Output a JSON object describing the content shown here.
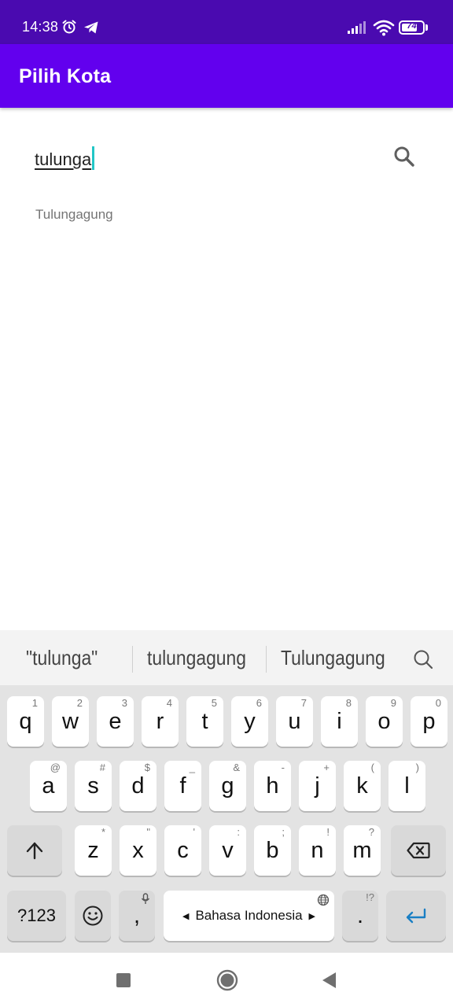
{
  "status_bar": {
    "time": "14:38",
    "battery_level": "74",
    "battery_fraction": 0.74,
    "icons": [
      "alarm-icon",
      "telegram-icon",
      "signal-icon",
      "wifi-icon",
      "battery-icon"
    ]
  },
  "app_bar": {
    "title": "Pilih Kota",
    "color": "#6200ee"
  },
  "search": {
    "value": "tulunga",
    "icon": "search-icon",
    "caret_color": "#22c6c6"
  },
  "suggestions_list": [
    "Tulungagung"
  ],
  "keyboard": {
    "suggestions": [
      "\"tulunga\"",
      "tulungagung",
      "Tulungagung"
    ],
    "row1": [
      {
        "key": "q",
        "hint": "1"
      },
      {
        "key": "w",
        "hint": "2"
      },
      {
        "key": "e",
        "hint": "3"
      },
      {
        "key": "r",
        "hint": "4"
      },
      {
        "key": "t",
        "hint": "5"
      },
      {
        "key": "y",
        "hint": "6"
      },
      {
        "key": "u",
        "hint": "7"
      },
      {
        "key": "i",
        "hint": "8"
      },
      {
        "key": "o",
        "hint": "9"
      },
      {
        "key": "p",
        "hint": "0"
      }
    ],
    "row2": [
      {
        "key": "a",
        "hint": "@"
      },
      {
        "key": "s",
        "hint": "#"
      },
      {
        "key": "d",
        "hint": "$"
      },
      {
        "key": "f",
        "hint": "_"
      },
      {
        "key": "g",
        "hint": "&"
      },
      {
        "key": "h",
        "hint": "-"
      },
      {
        "key": "j",
        "hint": "+"
      },
      {
        "key": "k",
        "hint": "("
      },
      {
        "key": "l",
        "hint": ")"
      }
    ],
    "row3": [
      {
        "key": "z",
        "hint": "*"
      },
      {
        "key": "x",
        "hint": "\""
      },
      {
        "key": "c",
        "hint": "'"
      },
      {
        "key": "v",
        "hint": ":"
      },
      {
        "key": "b",
        "hint": ";"
      },
      {
        "key": "n",
        "hint": "!"
      },
      {
        "key": "m",
        "hint": "?"
      }
    ],
    "symbols_key": "?123",
    "comma_key": ",",
    "space_label": "Bahasa Indonesia",
    "period_key": ".",
    "period_hint": "!?"
  }
}
